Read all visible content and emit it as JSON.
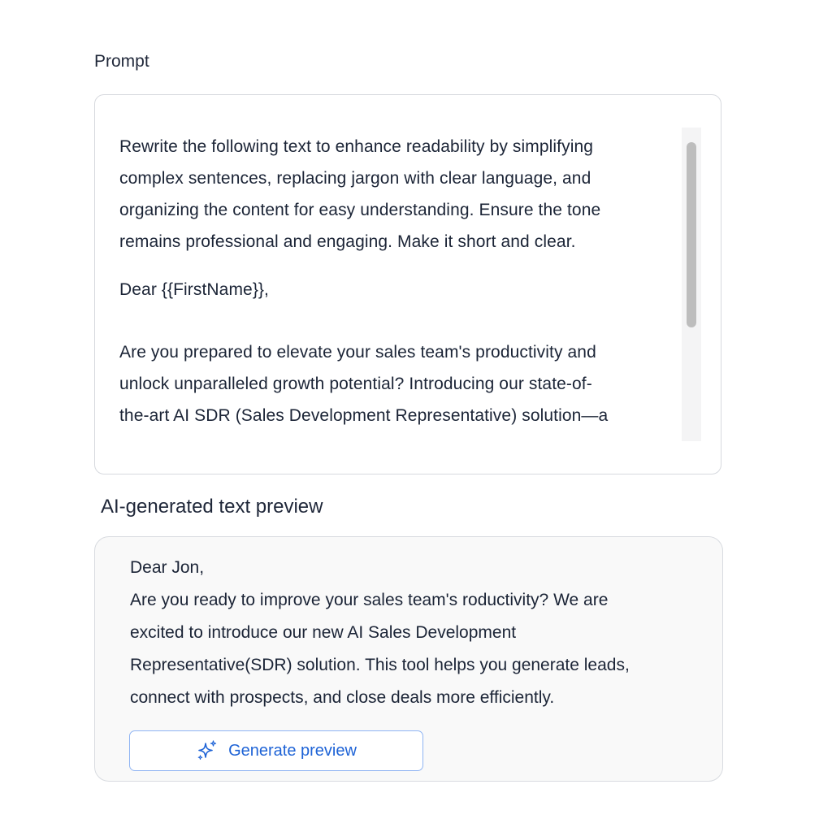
{
  "prompt": {
    "label": "Prompt",
    "lines_para1": [
      "Rewrite the following text to enhance readability by simplifying",
      "complex sentences, replacing jargon with clear language, and",
      "organizing the content for easy understanding. Ensure the tone",
      "remains professional and engaging. Make it short and clear."
    ],
    "greeting": "Dear {{FirstName}},",
    "lines_para3": [
      "Are you prepared to elevate your sales team's productivity and",
      "unlock unparalleled growth potential? Introducing our state-of-",
      "the-art AI SDR (Sales Development Representative) solution—a"
    ],
    "scroll_position": 0.05
  },
  "preview": {
    "label": "AI-generated text preview",
    "lines": [
      "Dear Jon,",
      "Are you ready to improve your sales team's roductivity? We are",
      "excited to introduce our new AI Sales Development",
      "Representative(SDR) solution. This tool helps you generate leads,",
      "connect with prospects, and close deals more efficiently."
    ],
    "button_label": "Generate preview",
    "button_icon": "sparkle-icon"
  },
  "colors": {
    "accent": "#1e63d6",
    "button_border": "#8fb4f3",
    "text": "#1b2436"
  }
}
